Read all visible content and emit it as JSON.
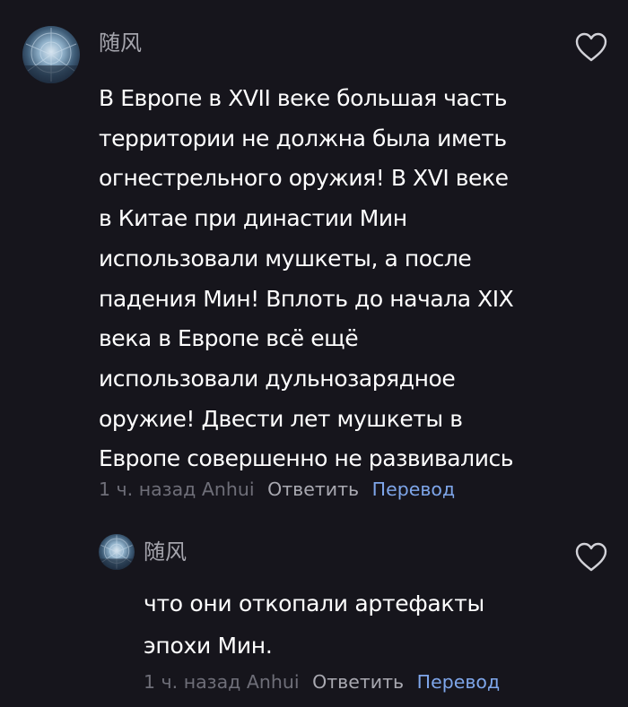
{
  "comments": [
    {
      "username": "随风",
      "text": "В Европе в XVII веке большая часть\nтерритории не должна была иметь\nогнестрельного оружия! В XVI веке\nв Китае при династии Мин\nиспользовали мушкеты, а после\nпадения Мин! Вплоть до начала XIX\nвека в Европе всё ещё\nиспользовали дульнозарядное\nоружие! Двести лет мушкеты в\nЕвропе совершенно не развивались",
      "time": "1 ч. назад",
      "location": "Anhui",
      "reply_label": "Ответить",
      "translate_label": "Перевод",
      "like_icon": "heart-outline-icon"
    },
    {
      "username": "随风",
      "text": "что они откопали артефакты\nэпохи Мин.",
      "time": "1 ч. назад",
      "location": "Anhui",
      "reply_label": "Ответить",
      "translate_label": "Перевод",
      "like_icon": "heart-outline-icon"
    }
  ],
  "colors": {
    "background": "#16151c",
    "text": "#ffffff",
    "username": "#a5a5ad",
    "time": "#6e6e78",
    "reply": "#a9a9b1",
    "translate": "#7ea6ea"
  }
}
